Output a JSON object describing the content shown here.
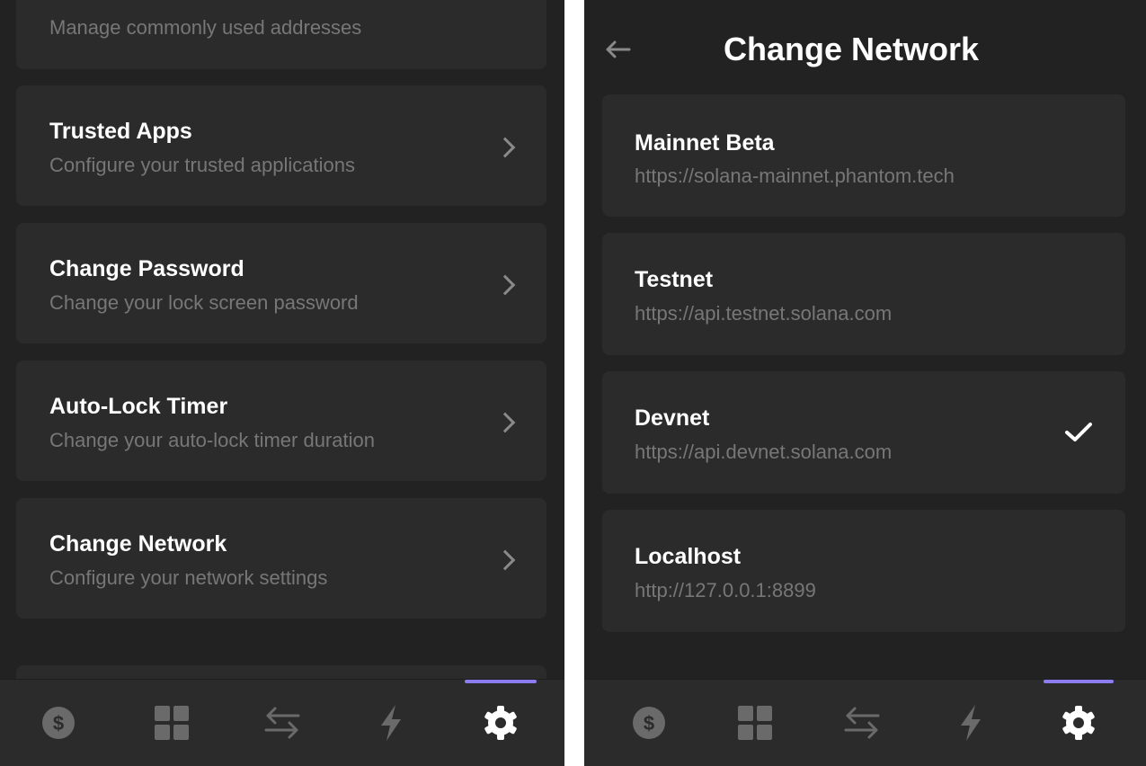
{
  "settings": {
    "items": [
      {
        "title": "",
        "subtitle": "Manage commonly used addresses"
      },
      {
        "title": "Trusted Apps",
        "subtitle": "Configure your trusted applications"
      },
      {
        "title": "Change Password",
        "subtitle": "Change your lock screen password"
      },
      {
        "title": "Auto-Lock Timer",
        "subtitle": "Change your auto-lock timer duration"
      },
      {
        "title": "Change Network",
        "subtitle": "Configure your network settings"
      }
    ]
  },
  "network": {
    "header_title": "Change Network",
    "selected": "Devnet",
    "items": [
      {
        "title": "Mainnet Beta",
        "url": "https://solana-mainnet.phantom.tech"
      },
      {
        "title": "Testnet",
        "url": "https://api.testnet.solana.com"
      },
      {
        "title": "Devnet",
        "url": "https://api.devnet.solana.com"
      },
      {
        "title": "Localhost",
        "url": "http://127.0.0.1:8899"
      }
    ]
  },
  "tabbar": {
    "icons": [
      "dollar-icon",
      "grid-icon",
      "swap-icon",
      "lightning-icon",
      "gear-icon"
    ],
    "active": "gear-icon",
    "dollar_glyph": "$"
  },
  "colors": {
    "background": "#222222",
    "card": "#2b2b2b",
    "accent": "#8b7cf0",
    "title": "#ffffff",
    "subtitle": "#777777"
  }
}
